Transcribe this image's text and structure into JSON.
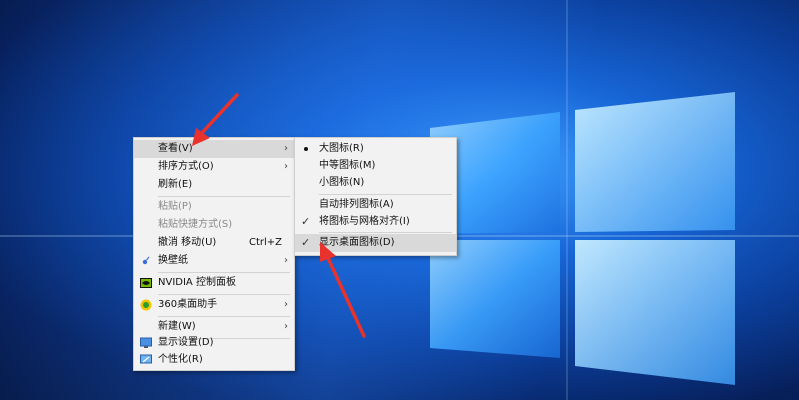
{
  "menu": {
    "items": [
      {
        "label": "查看(V)",
        "has_submenu": true
      },
      {
        "label": "排序方式(O)",
        "has_submenu": true
      },
      {
        "label": "刷新(E)"
      },
      {
        "label": "粘贴(P)",
        "disabled": true
      },
      {
        "label": "粘贴快捷方式(S)",
        "disabled": true
      },
      {
        "label": "撤消 移动(U)",
        "shortcut": "Ctrl+Z"
      },
      {
        "label": "换壁纸",
        "has_submenu": true
      },
      {
        "label": "NVIDIA 控制面板"
      },
      {
        "label": "360桌面助手",
        "has_submenu": true
      },
      {
        "label": "新建(W)",
        "has_submenu": true
      },
      {
        "label": "显示设置(D)"
      },
      {
        "label": "个性化(R)"
      }
    ],
    "arrow_glyph": "›"
  },
  "submenu": {
    "items": [
      {
        "label": "大图标(R)",
        "marker": "dot"
      },
      {
        "label": "中等图标(M)"
      },
      {
        "label": "小图标(N)"
      },
      {
        "label": "自动排列图标(A)"
      },
      {
        "label": "将图标与网格对齐(I)",
        "marker": "check"
      },
      {
        "label": "显示桌面图标(D)",
        "marker": "check"
      }
    ],
    "check_glyph": "✓"
  },
  "colors": {
    "annotation_arrow": "#e8322b",
    "menu_bg": "#f2f2f2",
    "menu_highlight": "#d9d9d9"
  }
}
